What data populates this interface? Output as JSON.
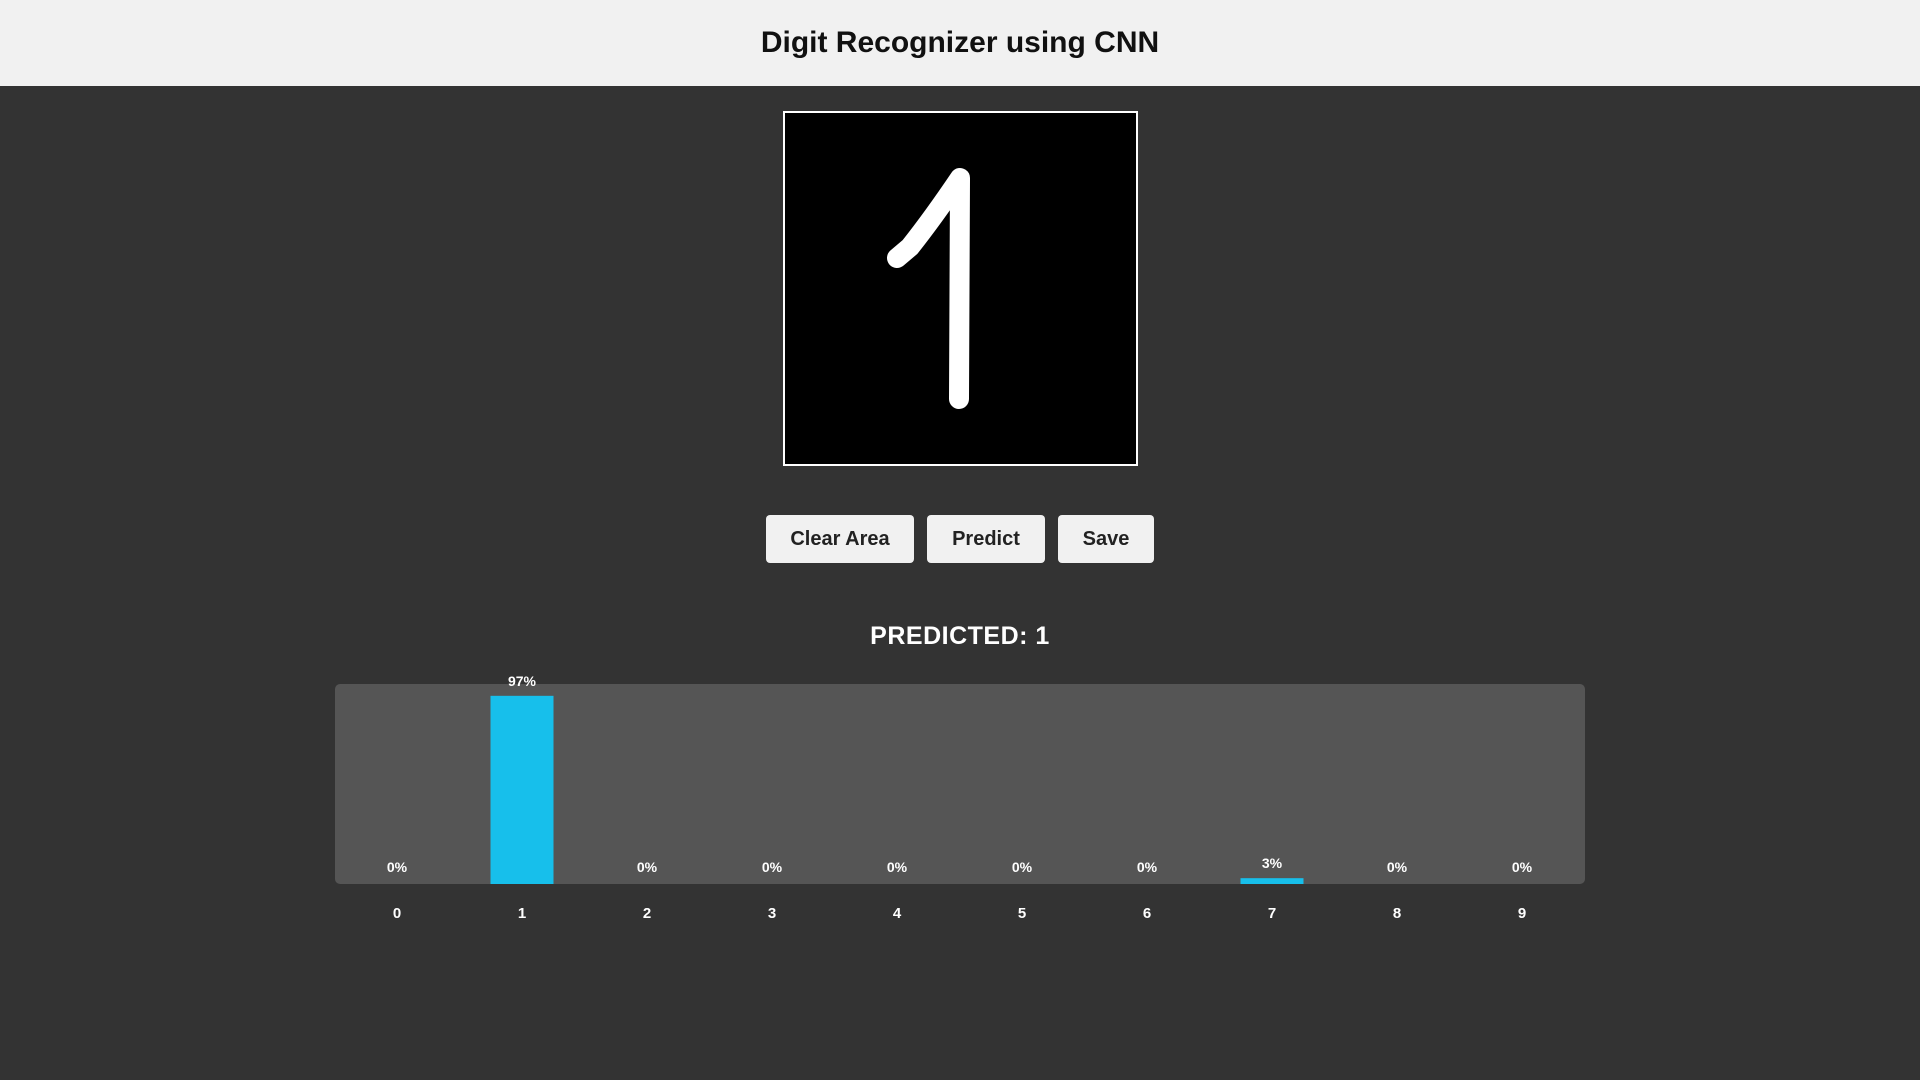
{
  "header": {
    "title": "Digit Recognizer using CNN"
  },
  "buttons": {
    "clear_label": "Clear Area",
    "predict_label": "Predict",
    "save_label": "Save"
  },
  "prediction": {
    "text": "PREDICTED: 1"
  },
  "colors": {
    "accent": "#17bfeb",
    "background": "#333333",
    "header_bg": "#f1f1f1",
    "chart_bg": "#555555"
  },
  "chart_data": {
    "type": "bar",
    "categories": [
      "0",
      "1",
      "2",
      "3",
      "4",
      "5",
      "6",
      "7",
      "8",
      "9"
    ],
    "values": [
      0,
      97,
      0,
      0,
      0,
      0,
      0,
      3,
      0,
      0
    ],
    "value_labels": [
      "0%",
      "97%",
      "0%",
      "0%",
      "0%",
      "0%",
      "0%",
      "3%",
      "0%",
      "0%"
    ],
    "ylim": [
      0,
      100
    ]
  }
}
